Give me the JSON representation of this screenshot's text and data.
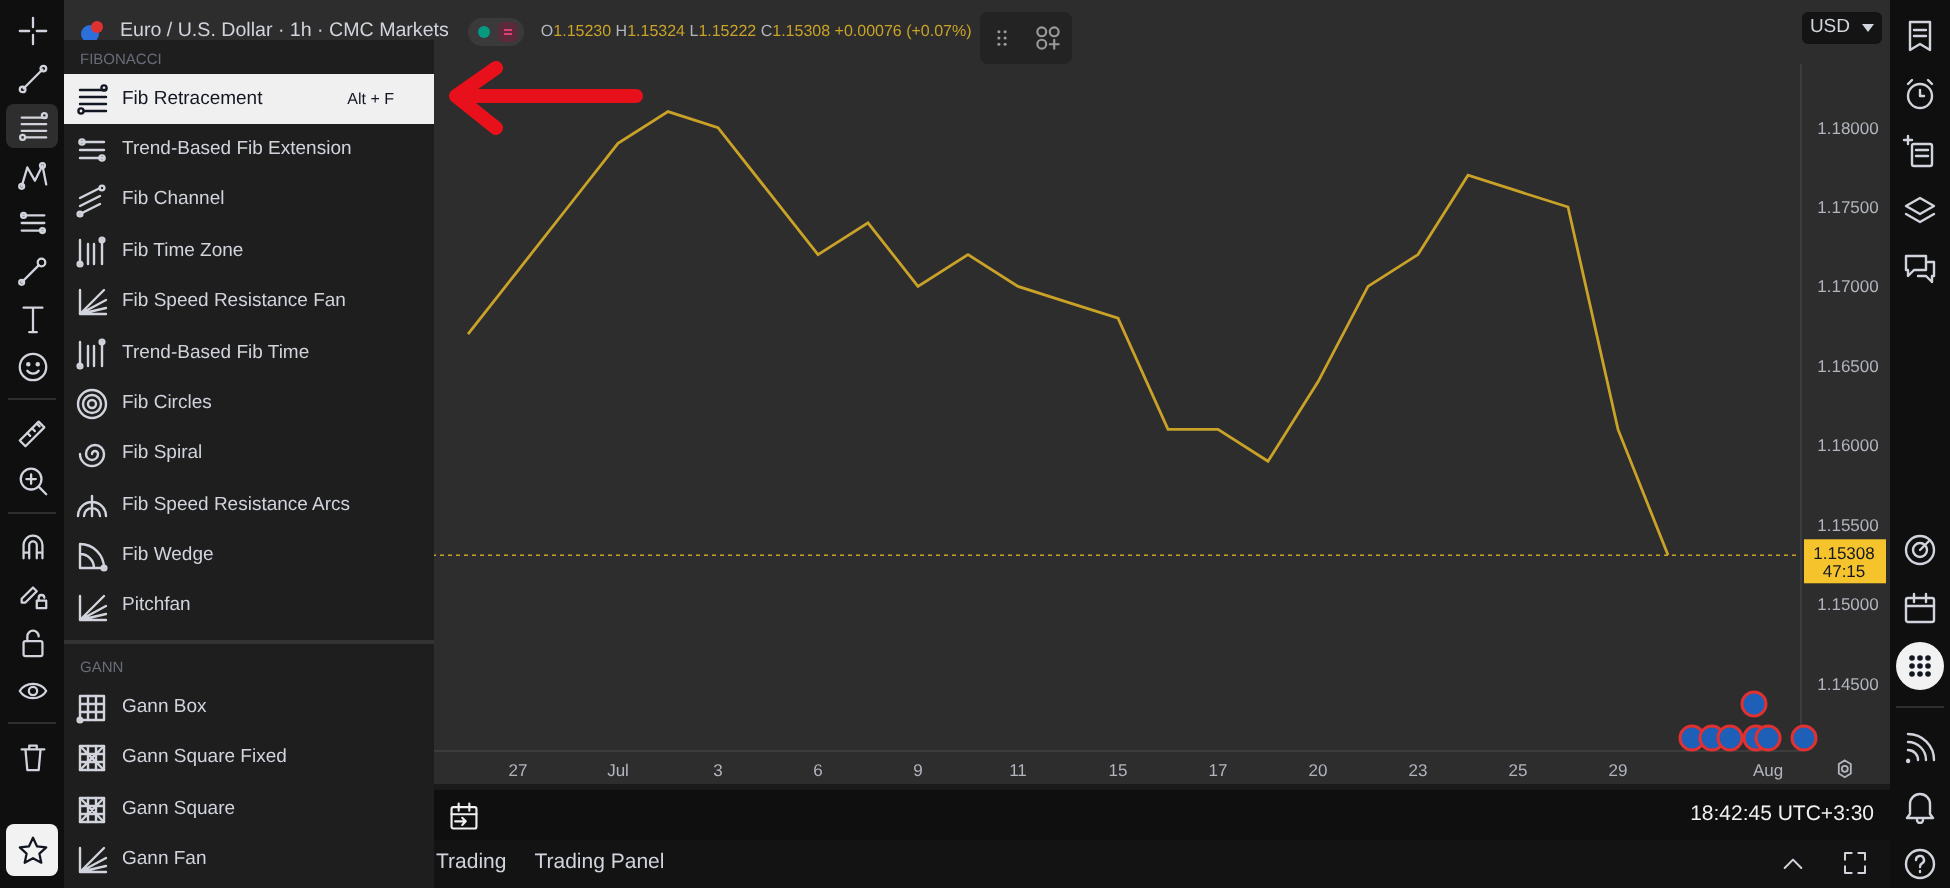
{
  "header": {
    "symbol": "Euro / U.S. Dollar · 1h · CMC Markets",
    "ohlc": [
      {
        "label": "O",
        "value": "1.15230"
      },
      {
        "label": "H",
        "value": "1.15324"
      },
      {
        "label": "L",
        "value": "1.15222"
      },
      {
        "label": "C",
        "value": "1.15308"
      }
    ],
    "change": "+0.00076 (+0.07%)",
    "currency": "USD"
  },
  "left_toolbar": {
    "tools": [
      {
        "selected": false
      },
      {
        "selected": false
      },
      {
        "selected": true
      },
      {
        "selected": false
      },
      {
        "selected": false
      },
      {
        "selected": false
      },
      {
        "selected": false
      },
      {
        "selected": false
      },
      {
        "selected": false
      },
      {
        "selected": false
      },
      {
        "selected": false
      },
      {
        "selected": false
      },
      {
        "selected": false
      },
      {
        "selected": false
      },
      {
        "selected": false
      }
    ],
    "favorites": {
      "selected": true
    }
  },
  "menu": {
    "sections": [
      {
        "heading": "FIBONACCI",
        "items": [
          {
            "label": "Fib Retracement",
            "shortcut": "Alt + F",
            "selected": true
          },
          {
            "label": "Trend-Based Fib Extension",
            "selected": false
          },
          {
            "label": "Fib Channel",
            "selected": false
          },
          {
            "label": "Fib Time Zone",
            "selected": false
          },
          {
            "label": "Fib Speed Resistance Fan",
            "selected": false
          },
          {
            "label": "Trend-Based Fib Time",
            "selected": false
          },
          {
            "label": "Fib Circles",
            "selected": false
          },
          {
            "label": "Fib Spiral",
            "selected": false
          },
          {
            "label": "Fib Speed Resistance Arcs",
            "selected": false
          },
          {
            "label": "Fib Wedge",
            "selected": false
          },
          {
            "label": "Pitchfan",
            "selected": false
          }
        ]
      },
      {
        "heading": "GANN",
        "items": [
          {
            "label": "Gann Box",
            "selected": false
          },
          {
            "label": "Gann Square Fixed",
            "selected": false
          },
          {
            "label": "Gann Square",
            "selected": false
          },
          {
            "label": "Gann Fan",
            "selected": false
          }
        ]
      }
    ]
  },
  "chart": {
    "chart_data": {
      "type": "line",
      "categories": [
        null,
        null,
        "27",
        null,
        "Jul",
        null,
        "3",
        null,
        "6",
        null,
        "9",
        null,
        "11",
        null,
        "15",
        null,
        "17",
        null,
        "20",
        null,
        "23",
        null,
        "25",
        null,
        "29",
        null,
        null,
        "Aug"
      ],
      "series": [
        {
          "color": "#c9a227",
          "values": [
            null,
            1.167,
            1.171,
            1.175,
            1.179,
            1.181,
            1.18,
            1.176,
            1.172,
            1.174,
            1.17,
            1.172,
            1.17,
            1.169,
            1.168,
            1.161,
            1.161,
            1.159,
            1.164,
            1.17,
            1.172,
            1.177,
            1.176,
            1.175,
            1.161,
            1.1531,
            null,
            null
          ]
        }
      ],
      "ylim": [
        1.1407,
        1.184
      ],
      "ref_lines": [
        {
          "axis": "y",
          "value": 1.15308,
          "color": "#c9a227"
        }
      ],
      "yticks": [
        {
          "value": 1.145,
          "label": "1.14500"
        },
        {
          "value": 1.15,
          "label": "1.15000"
        },
        {
          "value": 1.155,
          "label": "1.15500"
        },
        {
          "value": 1.16,
          "label": "1.16000"
        },
        {
          "value": 1.165,
          "label": "1.16500"
        },
        {
          "value": 1.17,
          "label": "1.17000"
        },
        {
          "value": 1.175,
          "label": "1.17500"
        },
        {
          "value": 1.18,
          "label": "1.18000"
        }
      ]
    },
    "price_label": {
      "price": "1.15308",
      "countdown": "47:15"
    }
  },
  "status_bar": {
    "time": "18:42:45 UTC+3:30"
  },
  "bottom_panel": {
    "tabs": [
      {
        "label": "Trading"
      },
      {
        "label": "Trading Panel"
      }
    ]
  },
  "right_toolbar": {
    "tools": [
      {
        "selected": false
      },
      {
        "selected": false
      },
      {
        "selected": false
      },
      {
        "selected": false
      },
      {
        "selected": false
      },
      {
        "selected": false
      },
      {
        "selected": false
      },
      {
        "selected": true
      },
      {
        "selected": false
      },
      {
        "selected": false
      },
      {
        "selected": false
      }
    ]
  }
}
